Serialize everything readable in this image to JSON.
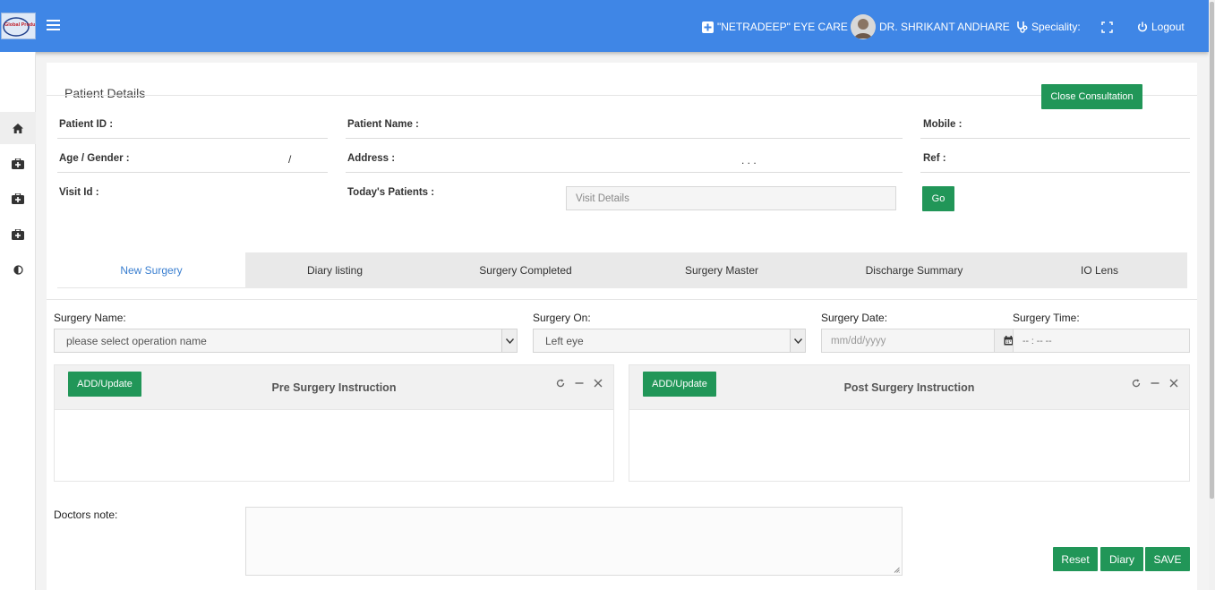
{
  "header": {
    "logo_text": "Global Products",
    "clinic_name": "\"NETRADEEP\" EYE CARE",
    "doctor_name": "DR. SHRIKANT ANDHARE",
    "speciality_label": "Speciality:",
    "logout_label": "Logout",
    "brand_color": "#3f86e6"
  },
  "sidebar": {
    "items": [
      {
        "icon": "home-icon"
      },
      {
        "icon": "medkit-icon"
      },
      {
        "icon": "medkit-icon"
      },
      {
        "icon": "medkit-icon"
      },
      {
        "icon": "contrast-icon"
      }
    ]
  },
  "patient": {
    "section_title": "Patient Details",
    "close_button": "Close Consultation",
    "patient_id_label": "Patient ID :",
    "patient_name_label": "Patient Name :",
    "mobile_label": "Mobile :",
    "age_gender_label": "Age / Gender :",
    "age_gender_sep": "/",
    "address_label": "Address :",
    "address_value": ". . .",
    "ref_label": "Ref :",
    "visit_id_label": "Visit Id :",
    "todays_patients_label": "Today's Patients :",
    "visit_details_placeholder": "Visit Details",
    "go_button": "Go"
  },
  "tabs": [
    {
      "label": "New Surgery",
      "active": true
    },
    {
      "label": "Diary listing",
      "active": false
    },
    {
      "label": "Surgery Completed",
      "active": false
    },
    {
      "label": "Surgery Master",
      "active": false
    },
    {
      "label": "Discharge Summary",
      "active": false
    },
    {
      "label": "IO Lens",
      "active": false
    }
  ],
  "surgery_form": {
    "surgery_name_label": "Surgery Name:",
    "surgery_name_value": "please select operation name",
    "surgery_on_label": "Surgery On:",
    "surgery_on_value": "Left eye",
    "surgery_date_label": "Surgery Date:",
    "surgery_date_placeholder": "mm/dd/yyyy",
    "surgery_time_label": "Surgery Time:",
    "surgery_time_placeholder": "-- : --   --"
  },
  "panels": {
    "pre": {
      "add_button": "ADD/Update",
      "title": "Pre Surgery Instruction"
    },
    "post": {
      "add_button": "ADD/Update",
      "title": "Post Surgery Instruction"
    }
  },
  "notes": {
    "label": "Doctors note:",
    "value": ""
  },
  "actions": {
    "reset": "Reset",
    "diary": "Diary",
    "save": "SAVE",
    "button_color": "#219658"
  }
}
